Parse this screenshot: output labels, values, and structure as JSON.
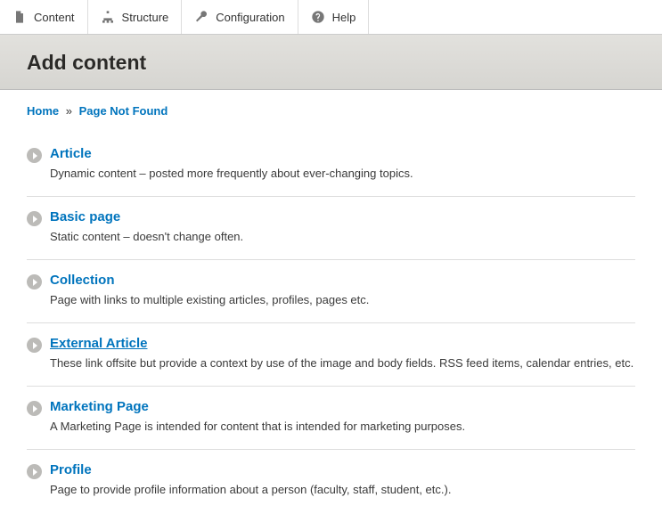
{
  "toolbar": {
    "items": [
      {
        "label": "Content"
      },
      {
        "label": "Structure"
      },
      {
        "label": "Configuration"
      },
      {
        "label": "Help"
      }
    ]
  },
  "page": {
    "title": "Add content"
  },
  "breadcrumb": {
    "home": "Home",
    "sep": "»",
    "current": "Page Not Found"
  },
  "types": [
    {
      "title": "Article",
      "desc": "Dynamic content – posted more frequently about ever-changing topics."
    },
    {
      "title": "Basic page",
      "desc": "Static content – doesn't change often."
    },
    {
      "title": "Collection",
      "desc": "Page with links to multiple existing articles, profiles, pages etc."
    },
    {
      "title": "External Article",
      "desc": "These link offsite but provide a context by use of the image and body fields. RSS feed items, calendar entries, etc.",
      "underline": true
    },
    {
      "title": "Marketing Page",
      "desc": "A Marketing Page is intended for content that is intended for marketing purposes."
    },
    {
      "title": "Profile",
      "desc": "Page to provide profile information about a person (faculty, staff, student, etc.)."
    }
  ]
}
